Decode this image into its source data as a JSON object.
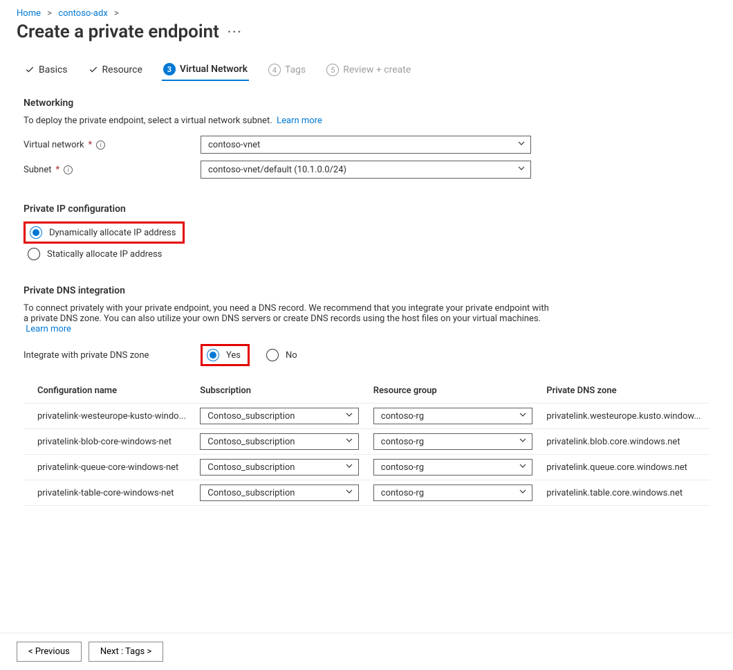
{
  "breadcrumb": {
    "home": "Home",
    "resource": "contoso-adx"
  },
  "page_title": "Create a private endpoint",
  "tabs": {
    "basics": "Basics",
    "resource": "Resource",
    "vnet": "Virtual Network",
    "tags": "Tags",
    "review": "Review + create",
    "tags_num": "4",
    "review_num": "5",
    "vnet_num": "3"
  },
  "networking": {
    "heading": "Networking",
    "desc": "To deploy the private endpoint, select a virtual network subnet.",
    "learn_more": "Learn more",
    "vnet_label": "Virtual network",
    "vnet_value": "contoso-vnet",
    "subnet_label": "Subnet",
    "subnet_value": "contoso-vnet/default (10.1.0.0/24)"
  },
  "ipconfig": {
    "heading": "Private IP configuration",
    "dynamic": "Dynamically allocate IP address",
    "static": "Statically allocate IP address"
  },
  "dns": {
    "heading": "Private DNS integration",
    "desc": "To connect privately with your private endpoint, you need a DNS record. We recommend that you integrate your private endpoint with a private DNS zone. You can also utilize your own DNS servers or create DNS records using the host files on your virtual machines.",
    "learn_more": "Learn more",
    "integrate_label": "Integrate with private DNS zone",
    "yes": "Yes",
    "no": "No",
    "cols": {
      "config": "Configuration name",
      "sub": "Subscription",
      "rg": "Resource group",
      "zone": "Private DNS zone"
    },
    "rows": [
      {
        "config": "privatelink-westeurope-kusto-windo...",
        "sub": "Contoso_subscription",
        "rg": "contoso-rg",
        "zone": "privatelink.westeurope.kusto.window..."
      },
      {
        "config": "privatelink-blob-core-windows-net",
        "sub": "Contoso_subscription",
        "rg": "contoso-rg",
        "zone": "privatelink.blob.core.windows.net"
      },
      {
        "config": "privatelink-queue-core-windows-net",
        "sub": "Contoso_subscription",
        "rg": "contoso-rg",
        "zone": "privatelink.queue.core.windows.net"
      },
      {
        "config": "privatelink-table-core-windows-net",
        "sub": "Contoso_subscription",
        "rg": "contoso-rg",
        "zone": "privatelink.table.core.windows.net"
      }
    ]
  },
  "footer": {
    "prev": "<  Previous",
    "next": "Next : Tags  >"
  }
}
